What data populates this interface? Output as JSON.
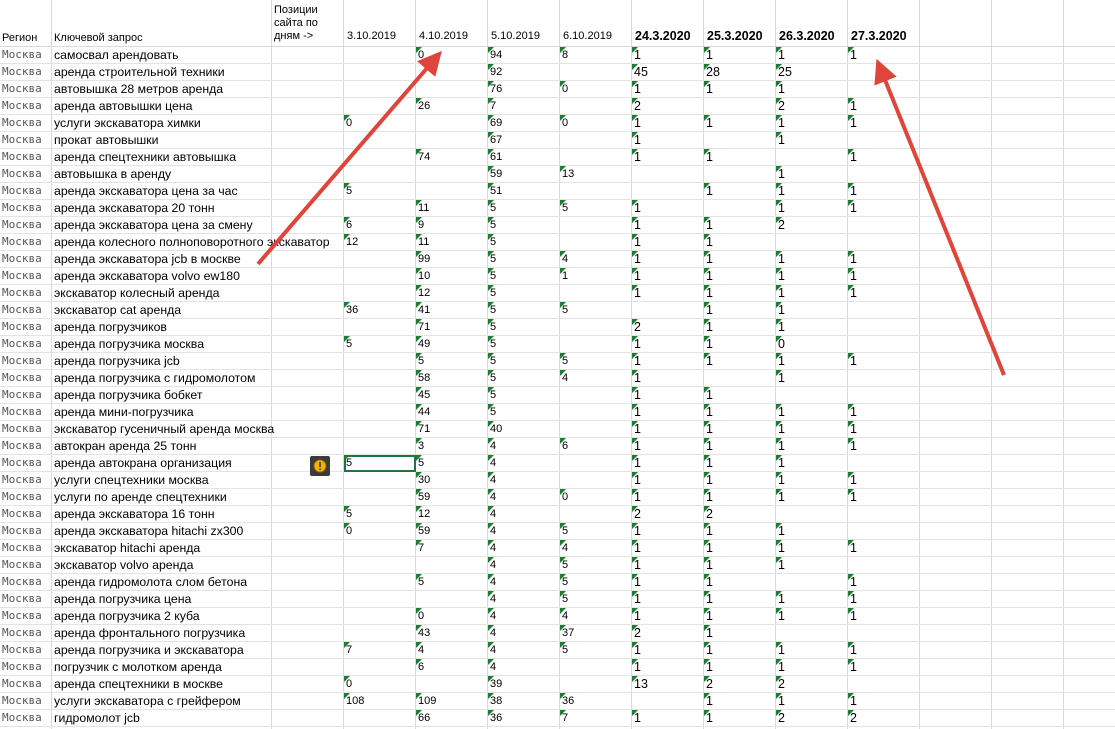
{
  "columns": {
    "region": "Регион",
    "keyword": "Ключевой запрос",
    "positions": "Позиции сайта по дням ->",
    "dates": [
      "3.10.2019",
      "4.10.2019",
      "5.10.2019",
      "6.10.2019",
      "24.3.2020",
      "25.3.2020",
      "26.3.2020",
      "27.3.2020"
    ]
  },
  "rows": [
    {
      "region": "Москва",
      "keyword": "самосвал арендовать",
      "v": [
        "",
        "0",
        "94",
        "8",
        "1",
        "1",
        "1",
        "1"
      ]
    },
    {
      "region": "Москва",
      "keyword": "аренда строительной техники",
      "v": [
        "",
        "",
        "92",
        "",
        "45",
        "28",
        "25",
        ""
      ]
    },
    {
      "region": "Москва",
      "keyword": "автовышка 28 метров аренда",
      "v": [
        "",
        "",
        "76",
        "0",
        "1",
        "1",
        "1",
        ""
      ]
    },
    {
      "region": "Москва",
      "keyword": "аренда автовышки цена",
      "v": [
        "",
        "26",
        "7",
        "",
        "2",
        "",
        "2",
        "1"
      ]
    },
    {
      "region": "Москва",
      "keyword": "услуги экскаватора химки",
      "v": [
        "0",
        "",
        "69",
        "0",
        "1",
        "1",
        "1",
        "1"
      ]
    },
    {
      "region": "Москва",
      "keyword": "прокат автовышки",
      "v": [
        "",
        "",
        "67",
        "",
        "1",
        "",
        "1",
        ""
      ]
    },
    {
      "region": "Москва",
      "keyword": "аренда спецтехники автовышка",
      "v": [
        "",
        "74",
        "61",
        "",
        "1",
        "1",
        "",
        "1"
      ]
    },
    {
      "region": "Москва",
      "keyword": "автовышка в аренду",
      "v": [
        "",
        "",
        "59",
        "13",
        "",
        "",
        "1",
        ""
      ]
    },
    {
      "region": "Москва",
      "keyword": "аренда экскаватора цена за час",
      "v": [
        "5",
        "",
        "51",
        "",
        "",
        "1",
        "1",
        "1"
      ]
    },
    {
      "region": "Москва",
      "keyword": "аренда экскаватора 20 тонн",
      "v": [
        "",
        "11",
        "5",
        "5",
        "1",
        "",
        "1",
        "1"
      ]
    },
    {
      "region": "Москва",
      "keyword": "аренда экскаватора цена за смену",
      "v": [
        "6",
        "9",
        "5",
        "",
        "1",
        "1",
        "2",
        ""
      ]
    },
    {
      "region": "Москва",
      "keyword": "аренда колесного полноповоротного экскаватор",
      "v": [
        "12",
        "11",
        "5",
        "",
        "1",
        "1",
        "",
        ""
      ]
    },
    {
      "region": "Москва",
      "keyword": "аренда экскаватора jcb в москве",
      "v": [
        "",
        "99",
        "5",
        "4",
        "1",
        "1",
        "1",
        "1"
      ]
    },
    {
      "region": "Москва",
      "keyword": "аренда экскаватора volvo ew180",
      "v": [
        "",
        "10",
        "5",
        "1",
        "1",
        "1",
        "1",
        "1"
      ]
    },
    {
      "region": "Москва",
      "keyword": "экскаватор колесный аренда",
      "v": [
        "",
        "12",
        "5",
        "",
        "1",
        "1",
        "1",
        "1"
      ]
    },
    {
      "region": "Москва",
      "keyword": "экскаватор cat аренда",
      "v": [
        "36",
        "41",
        "5",
        "5",
        "",
        "1",
        "1",
        ""
      ]
    },
    {
      "region": "Москва",
      "keyword": "аренда погрузчиков",
      "v": [
        "",
        "71",
        "5",
        "",
        "2",
        "1",
        "1",
        ""
      ]
    },
    {
      "region": "Москва",
      "keyword": "аренда погрузчика москва",
      "v": [
        "5",
        "49",
        "5",
        "",
        "1",
        "1",
        "0",
        ""
      ]
    },
    {
      "region": "Москва",
      "keyword": "аренда погрузчика jcb",
      "v": [
        "",
        "5",
        "5",
        "5",
        "1",
        "1",
        "1",
        "1"
      ]
    },
    {
      "region": "Москва",
      "keyword": "аренда погрузчика с гидромолотом",
      "v": [
        "",
        "58",
        "5",
        "4",
        "1",
        "",
        "1",
        ""
      ]
    },
    {
      "region": "Москва",
      "keyword": "аренда погрузчика бобкет",
      "v": [
        "",
        "45",
        "5",
        "",
        "1",
        "1",
        "",
        ""
      ]
    },
    {
      "region": "Москва",
      "keyword": "аренда мини-погрузчика",
      "v": [
        "",
        "44",
        "5",
        "",
        "1",
        "1",
        "1",
        "1"
      ]
    },
    {
      "region": "Москва",
      "keyword": "экскаватор гусеничный аренда москва",
      "v": [
        "",
        "71",
        "40",
        "",
        "1",
        "1",
        "1",
        "1"
      ]
    },
    {
      "region": "Москва",
      "keyword": "автокран аренда 25 тонн",
      "v": [
        "",
        "3",
        "4",
        "6",
        "1",
        "1",
        "1",
        "1"
      ]
    },
    {
      "region": "Москва",
      "keyword": "аренда автокрана организация",
      "v": [
        "5",
        "5",
        "4",
        "",
        "1",
        "1",
        "1",
        ""
      ]
    },
    {
      "region": "Москва",
      "keyword": "услуги спецтехники москва",
      "v": [
        "",
        "30",
        "4",
        "",
        "1",
        "1",
        "1",
        "1"
      ]
    },
    {
      "region": "Москва",
      "keyword": "услуги по аренде спецтехники",
      "v": [
        "",
        "59",
        "4",
        "0",
        "1",
        "1",
        "1",
        "1"
      ]
    },
    {
      "region": "Москва",
      "keyword": "аренда экскаватора 16 тонн",
      "v": [
        "5",
        "12",
        "4",
        "",
        "2",
        "2",
        "",
        ""
      ]
    },
    {
      "region": "Москва",
      "keyword": "аренда экскаватора hitachi zx300",
      "v": [
        "0",
        "59",
        "4",
        "5",
        "1",
        "1",
        "1",
        ""
      ]
    },
    {
      "region": "Москва",
      "keyword": "экскаватор hitachi аренда",
      "v": [
        "",
        "7",
        "4",
        "4",
        "1",
        "1",
        "1",
        "1"
      ]
    },
    {
      "region": "Москва",
      "keyword": "экскаватор volvo аренда",
      "v": [
        "",
        "",
        "4",
        "5",
        "1",
        "1",
        "1",
        ""
      ]
    },
    {
      "region": "Москва",
      "keyword": "аренда гидромолота слом бетона",
      "v": [
        "",
        "5",
        "4",
        "5",
        "1",
        "1",
        "",
        "1"
      ]
    },
    {
      "region": "Москва",
      "keyword": "аренда погрузчика цена",
      "v": [
        "",
        "",
        "4",
        "5",
        "1",
        "1",
        "1",
        "1"
      ]
    },
    {
      "region": "Москва",
      "keyword": "аренда погрузчика 2 куба",
      "v": [
        "",
        "0",
        "4",
        "4",
        "1",
        "1",
        "1",
        "1"
      ]
    },
    {
      "region": "Москва",
      "keyword": "аренда фронтального погрузчика",
      "v": [
        "",
        "43",
        "4",
        "37",
        "2",
        "1",
        "",
        ""
      ]
    },
    {
      "region": "Москва",
      "keyword": "аренда погрузчика и экскаватора",
      "v": [
        "7",
        "4",
        "4",
        "5",
        "1",
        "1",
        "1",
        "1"
      ]
    },
    {
      "region": "Москва",
      "keyword": "погрузчик с молотком аренда",
      "v": [
        "",
        "6",
        "4",
        "",
        "1",
        "1",
        "1",
        "1"
      ]
    },
    {
      "region": "Москва",
      "keyword": "аренда спецтехники в москве",
      "v": [
        "0",
        "",
        "39",
        "",
        "13",
        "2",
        "2",
        ""
      ]
    },
    {
      "region": "Москва",
      "keyword": "услуги экскаватора с грейфером",
      "v": [
        "108",
        "109",
        "38",
        "36",
        "",
        "1",
        "1",
        "1"
      ]
    },
    {
      "region": "Москва",
      "keyword": "гидромолот jcb",
      "v": [
        "",
        "66",
        "36",
        "7",
        "1",
        "1",
        "2",
        "2"
      ]
    }
  ],
  "colors": {
    "flag": "#1e7b34",
    "grid": "#d9d9d9",
    "arrow": "#e0443b",
    "selection": "#217346"
  },
  "icons": {
    "warning": "warning-icon"
  }
}
